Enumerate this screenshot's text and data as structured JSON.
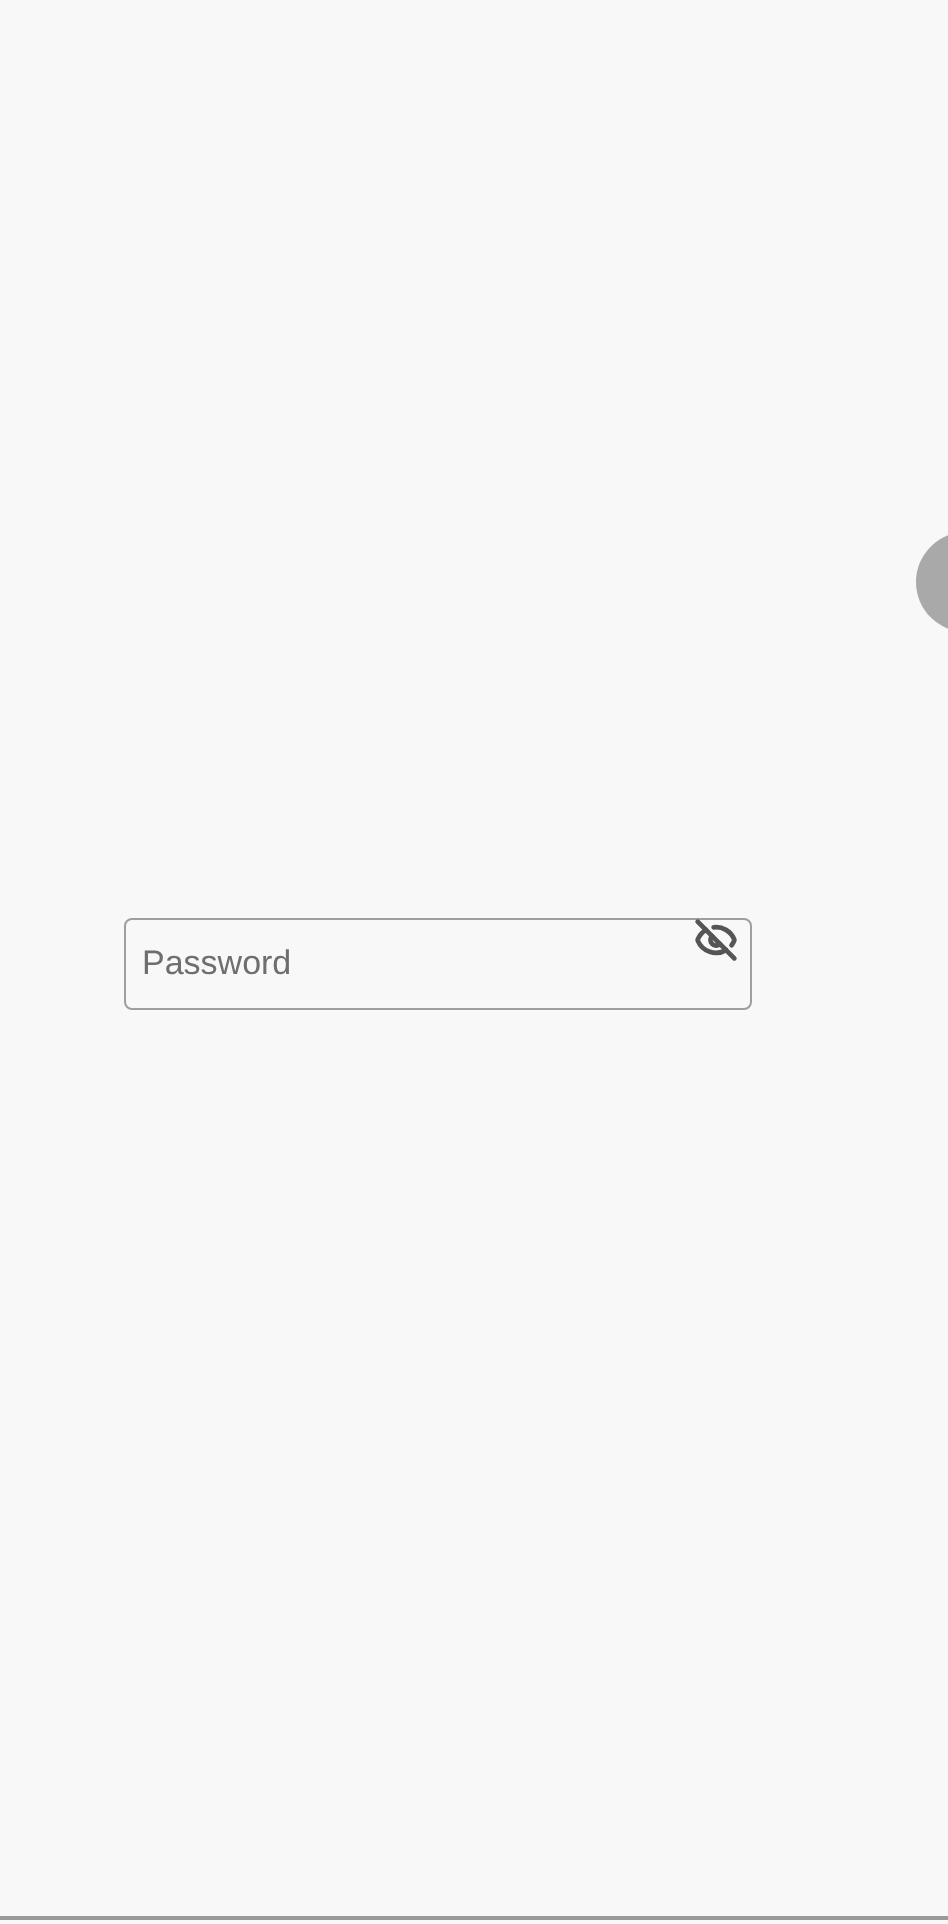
{
  "password_field": {
    "placeholder": "Password",
    "password_visible": false
  }
}
